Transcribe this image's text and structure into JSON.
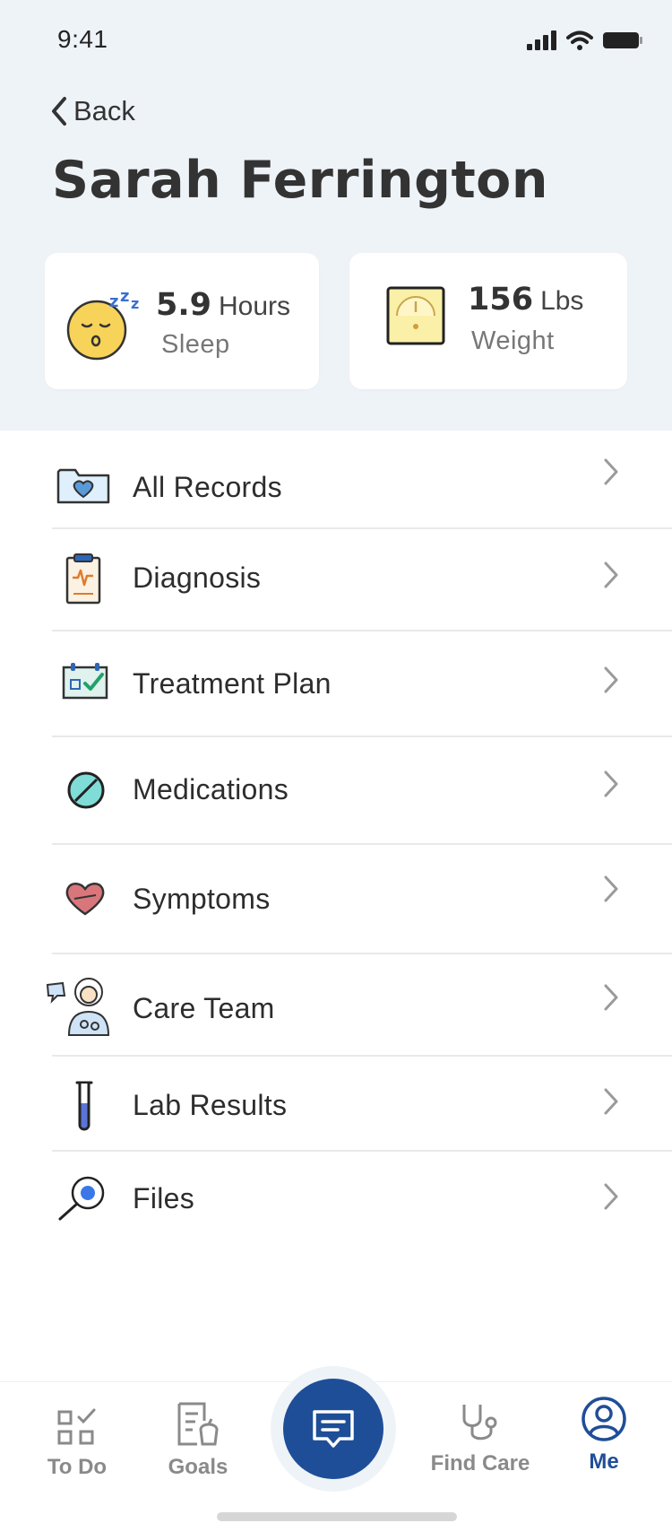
{
  "status_bar": {
    "time": "9:41"
  },
  "header": {
    "back_label": "Back",
    "title": "Sarah Ferrington"
  },
  "stats": {
    "sleep": {
      "value": "5.9",
      "unit": "Hours",
      "label": "Sleep",
      "icon": "sleeping-face-icon"
    },
    "weight": {
      "value": "156",
      "unit": "Lbs",
      "label": "Weight",
      "icon": "scale-icon"
    }
  },
  "menu": {
    "items": [
      {
        "label": "All Records",
        "icon": "folder-heart-icon"
      },
      {
        "label": "Diagnosis",
        "icon": "clipboard-icon"
      },
      {
        "label": "Treatment Plan",
        "icon": "calendar-check-icon"
      },
      {
        "label": "Medications",
        "icon": "pill-icon"
      },
      {
        "label": "Symptoms",
        "icon": "heart-icon"
      },
      {
        "label": "Care Team",
        "icon": "doctor-icon"
      },
      {
        "label": "Lab Results",
        "icon": "test-tube-icon"
      },
      {
        "label": "Files",
        "icon": "magnifier-icon"
      }
    ]
  },
  "tabbar": {
    "tabs": [
      {
        "label": "To Do",
        "icon": "checklist-icon",
        "active": false
      },
      {
        "label": "Goals",
        "icon": "goals-icon",
        "active": false
      },
      {
        "label": "",
        "icon": "chat-icon",
        "active": false
      },
      {
        "label": "Find Care",
        "icon": "stethoscope-icon",
        "active": false
      },
      {
        "label": "Me",
        "icon": "user-icon",
        "active": true
      }
    ]
  },
  "colors": {
    "header_bg": "#eef3f8",
    "accent": "#1f4e98",
    "text": "#2e2e2e",
    "muted": "#8a8a8a"
  }
}
